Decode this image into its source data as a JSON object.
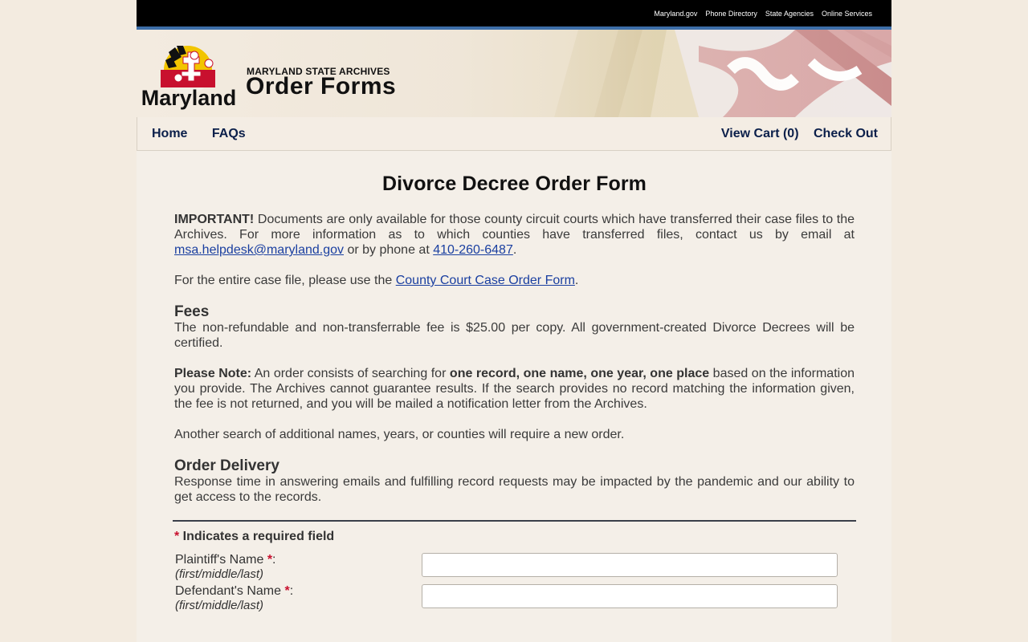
{
  "utility_links": [
    "Maryland.gov",
    "Phone Directory",
    "State Agencies",
    "Online Services"
  ],
  "header": {
    "logo_text": "Maryland",
    "subtitle": "MARYLAND STATE ARCHIVES",
    "title": "Order Forms"
  },
  "nav": {
    "home": "Home",
    "faqs": "FAQs",
    "view_cart": "View Cart (0)",
    "check_out": "Check Out"
  },
  "page": {
    "title": "Divorce Decree Order Form",
    "important_label": "IMPORTANT!",
    "important_text": " Documents are only available for those county circuit courts which have transferred their case files to the Archives. For more information as to which counties have transferred files, contact us by email at ",
    "email": "msa.helpdesk@maryland.gov",
    "phone_text": " or by phone at ",
    "phone": "410-260-6487",
    "period": ".",
    "case_text": "For the entire case file, please use the ",
    "case_link": "County Court Case Order Form",
    "fees_heading": "Fees",
    "fees_text": "The non-refundable and non-transferrable fee is $25.00 per copy. All government-created Divorce Decrees will be certified.",
    "note_label": "Please Note:",
    "note_text_1": " An order consists of searching for ",
    "note_bold": "one record, one name, one year, one place",
    "note_text_2": " based on the information you provide. The Archives cannot guarantee results. If the search provides no record matching the information given, the fee is not returned, and you will be mailed a notification letter from the Archives.",
    "another_search": "Another search of additional names, years, or counties will require a new order.",
    "delivery_heading": "Order Delivery",
    "delivery_text": "Response time in answering emails and fulfilling record requests may be impacted by the pandemic and our ability to get access to the records."
  },
  "form": {
    "required_star": "*",
    "required_note": " Indicates a required field",
    "plaintiff_label": "Plaintiff's Name ",
    "plaintiff_hint": "(first/middle/last)",
    "plaintiff_value": "",
    "defendant_label": "Defendant's Name ",
    "defendant_hint": "(first/middle/last)",
    "defendant_value": "",
    "colon": ":"
  },
  "colors": {
    "link": "#1a3fa0",
    "nav_text": "#0b1f4a",
    "required": "#c8102e",
    "utility_bar": "#000000",
    "accent_line": "#3d6ea8"
  }
}
